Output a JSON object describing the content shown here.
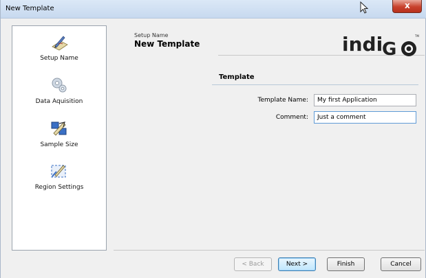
{
  "window": {
    "title": "New Template",
    "close_glyph": "x"
  },
  "sidebar": {
    "items": [
      {
        "label": "Setup Name",
        "icon": "pen-paper-icon"
      },
      {
        "label": "Data Aquisition",
        "icon": "gears-icon"
      },
      {
        "label": "Sample Size",
        "icon": "blocks-arrow-icon"
      },
      {
        "label": "Region Settings",
        "icon": "region-pen-icon"
      }
    ]
  },
  "header": {
    "subtitle": "Setup Name",
    "title": "New Template",
    "logo_text": "indiGO"
  },
  "form": {
    "section_title": "Template",
    "template_name_label": "Template Name:",
    "template_name_value": "My first Application",
    "comment_label": "Comment:",
    "comment_value": "Just a comment"
  },
  "buttons": {
    "back": "< Back",
    "next": "Next >",
    "finish": "Finish",
    "cancel": "Cancel"
  }
}
